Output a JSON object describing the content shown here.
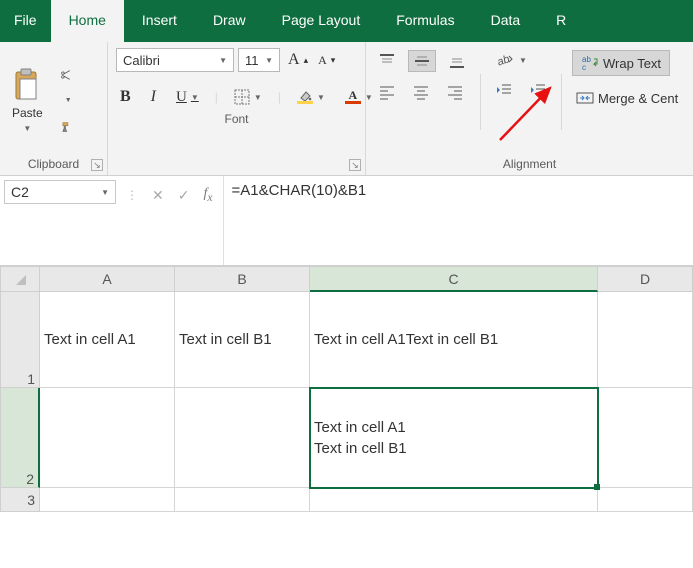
{
  "tabs": {
    "file": "File",
    "home": "Home",
    "insert": "Insert",
    "draw": "Draw",
    "page_layout": "Page Layout",
    "formulas": "Formulas",
    "data": "Data",
    "review_stub": "R"
  },
  "ribbon": {
    "clipboard": {
      "paste": "Paste",
      "title": "Clipboard"
    },
    "font": {
      "name": "Calibri",
      "size": "11",
      "bold": "B",
      "italic": "I",
      "underline": "U",
      "grow": "A",
      "shrink": "A",
      "fontcolor_label": "A",
      "title": "Font"
    },
    "alignment": {
      "wrap_text": "Wrap Text",
      "merge_center": "Merge & Cent",
      "title": "Alignment"
    }
  },
  "formula_bar": {
    "name_box": "C2",
    "formula": "=A1&CHAR(10)&B1"
  },
  "sheet": {
    "cols": [
      "A",
      "B",
      "C",
      "D"
    ],
    "rows": [
      "1",
      "2",
      "3"
    ],
    "cells": {
      "A1": "Text in cell A1",
      "B1": "Text in cell B1",
      "C1": "Text in cell A1Text in cell B1",
      "C2": "Text in cell A1\nText in cell B1"
    },
    "active_cell": "C2"
  }
}
